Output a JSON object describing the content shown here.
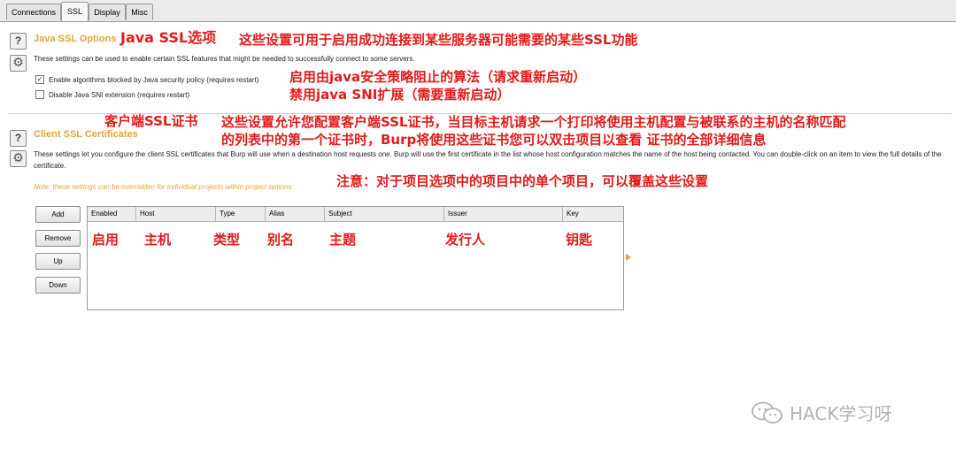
{
  "tabs": [
    {
      "label": "Connections"
    },
    {
      "label": "SSL"
    },
    {
      "label": "Display"
    },
    {
      "label": "Misc"
    }
  ],
  "java_ssl": {
    "title": "Java SSL Options",
    "title_cn": "Java SSL选项",
    "description": "These settings can be used to enable certain SSL features that might be needed to successfully connect to some servers.",
    "description_cn": "这些设置可用于启用成功连接到某些服务器可能需要的某些SSL功能",
    "options": [
      {
        "label": "Enable algorithms blocked by Java security policy (requires restart)",
        "checked": true,
        "label_cn": "启用由java安全策略阻止的算法（请求重新启动）"
      },
      {
        "label": "Disable Java SNI extension (requires restart)",
        "checked": false,
        "label_cn": "禁用java SNI扩展（需要重新启动）"
      }
    ]
  },
  "client_ssl": {
    "title": "Client SSL Certificates",
    "title_cn": "客户端SSL证书",
    "description": "These settings let you configure the client SSL certificates that Burp will use when a destination host requests one. Burp will use the first certificate in the list whose host configuration matches the name of the host being contacted. You can double-click on an item to view the full details of the certificate.",
    "description_cn_1": "这些设置允许您配置客户端SSL证书，当目标主机请求一个打印将使用主机配置与被联系的主机的名称匹配",
    "description_cn_2": "的列表中的第一个证书时，Burp将使用这些证书您可以双击项目以查看 证书的全部详细信息",
    "note": "Note: these settings can be overridden for individual projects within project options.",
    "note_cn": "注意：对于项目选项中的项目中的单个项目，可以覆盖这些设置",
    "buttons": {
      "add": "Add",
      "remove": "Remove",
      "up": "Up",
      "down": "Down"
    },
    "columns": [
      "Enabled",
      "Host",
      "Type",
      "Alias",
      "Subject",
      "Issuer",
      "Key"
    ],
    "columns_cn": [
      "启用",
      "主机",
      "类型",
      "别名",
      "主题",
      "发行人",
      "钥匙"
    ],
    "rows": []
  },
  "watermark": "HACK学习呀",
  "colors": {
    "section_title": "#e8a13a",
    "annotation": "#e21a1a"
  }
}
